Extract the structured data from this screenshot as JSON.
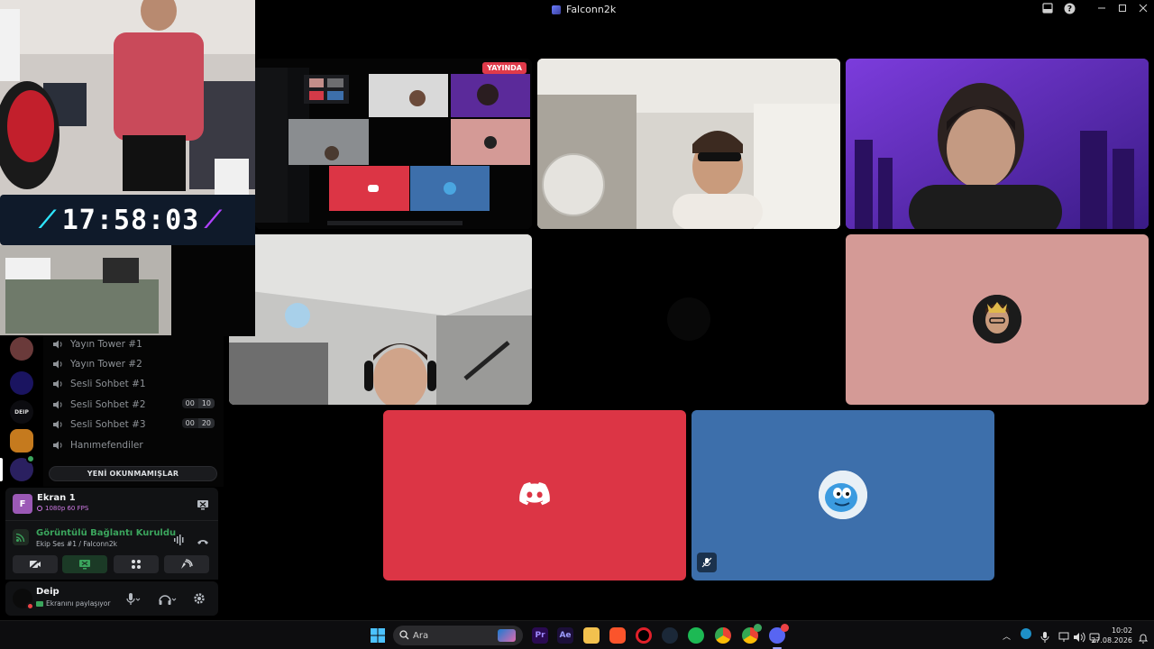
{
  "window": {
    "title": "Falconn2k"
  },
  "timer": {
    "value": "17:58:03"
  },
  "channels": [
    {
      "name": "Yayın Tower #1"
    },
    {
      "name": "Yayın Tower #2"
    },
    {
      "name": "Sesli Sohbet #1"
    },
    {
      "name": "Sesli Sohbet #2",
      "count_a": "00",
      "count_b": "10"
    },
    {
      "name": "Sesli Sohbet #3",
      "count_a": "00",
      "count_b": "20"
    },
    {
      "name": "Hanımefendiler"
    }
  ],
  "unread_label": "YENİ OKUNMAMIŞLAR",
  "stream": {
    "name": "Ekran 1",
    "quality": "1080p 60 FPS"
  },
  "voice": {
    "status": "Görüntülü Bağlantı Kuruldu",
    "location": "Ekip Ses #1 / Falconn2k"
  },
  "user": {
    "name": "Deip",
    "status": "Ekranını paylaşıyor"
  },
  "stage": {
    "live_badge": "YAYINDA"
  },
  "rail": {
    "server_label": "DEIP"
  },
  "taskbar": {
    "search_placeholder": "Ara",
    "time": "10:02",
    "date": "27.08.2026"
  },
  "colors": {
    "discord_red": "#dc3545",
    "discord_blue": "#3d6fab",
    "pink_tile": "#d49a96",
    "live_red": "#e03a4a",
    "voice_green": "#3ba55d"
  }
}
